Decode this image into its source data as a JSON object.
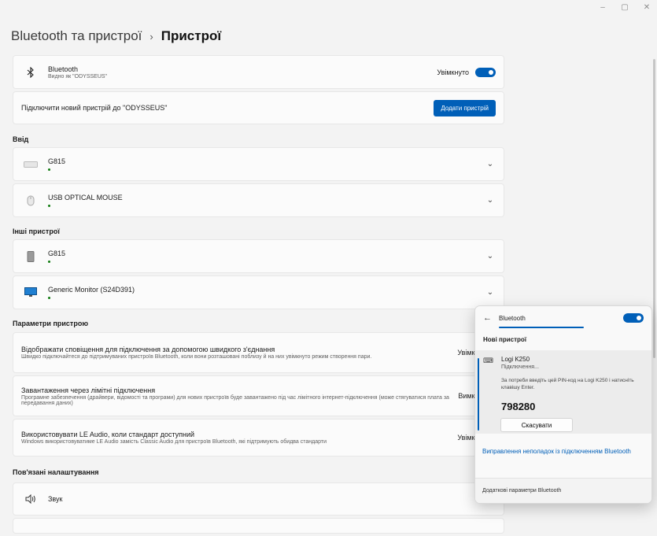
{
  "window": {
    "min": "–",
    "max": "▢",
    "close": "✕"
  },
  "breadcrumb": {
    "parent": "Bluetooth та пристрої",
    "sep": "›",
    "current": "Пристрої"
  },
  "bluetooth_row": {
    "title": "Bluetooth",
    "subtitle": "Видно як \"ODYSSEUS\"",
    "state": "Увімкнуто"
  },
  "add_row": {
    "title": "Підключити новий пристрій до \"ODYSSEUS\"",
    "button": "Додати пристрій"
  },
  "input_section": {
    "heading": "Ввід",
    "devices": [
      {
        "name": "G815",
        "icon": "keyboard-icon"
      },
      {
        "name": "USB OPTICAL MOUSE",
        "icon": "mouse-icon"
      }
    ]
  },
  "other_section": {
    "heading": "Інші пристрої",
    "devices": [
      {
        "name": "G815",
        "icon": "device-icon"
      },
      {
        "name": "Generic Monitor (S24D391)",
        "icon": "monitor-icon"
      }
    ]
  },
  "params_section": {
    "heading": "Параметри пристрою",
    "items": [
      {
        "title": "Відображати сповіщення для підключення за допомогою швидкого з'єднання",
        "subtitle": "Швидко підключайтеся до підтримуваних пристроїв Bluetooth, коли вони розташовані поблизу й на них увімкнуто режим створення пари.",
        "state": "Увімкнуто"
      },
      {
        "title": "Завантаження через лімітні підключення",
        "subtitle": "Програмне забезпечення (драйвери, відомості та програми) для нових пристроїв буде завантажено під час лімітного інтернет-підключення (може стягуватися плата за передавання даних)",
        "state": "Вимкнуто"
      },
      {
        "title": "Використовувати LE Audio, коли стандарт доступний",
        "subtitle": "Windows використовуватиме LE Audio замість Classic Audio для пристроїв Bluetooth, які підтримують обидва стандарти",
        "state": "Увімкнуто"
      }
    ]
  },
  "related_section": {
    "heading": "Пов'язані налаштування",
    "sound": "Звук"
  },
  "flyout": {
    "header": "Bluetooth",
    "section": "Нові пристрої",
    "device_name": "Logi K250",
    "device_status": "Підключення...",
    "pin_hint": "За потреби введіть цей PIN-код на Logi K250 і натисніть клавішу Enter.",
    "pin": "798280",
    "cancel": "Скасувати",
    "troubleshoot": "Виправлення неполадок із підключенням Bluetooth",
    "more": "Додаткові параметри Bluetooth"
  },
  "colors": {
    "accent": "#005fb8",
    "connected": "#0f7b0f"
  }
}
